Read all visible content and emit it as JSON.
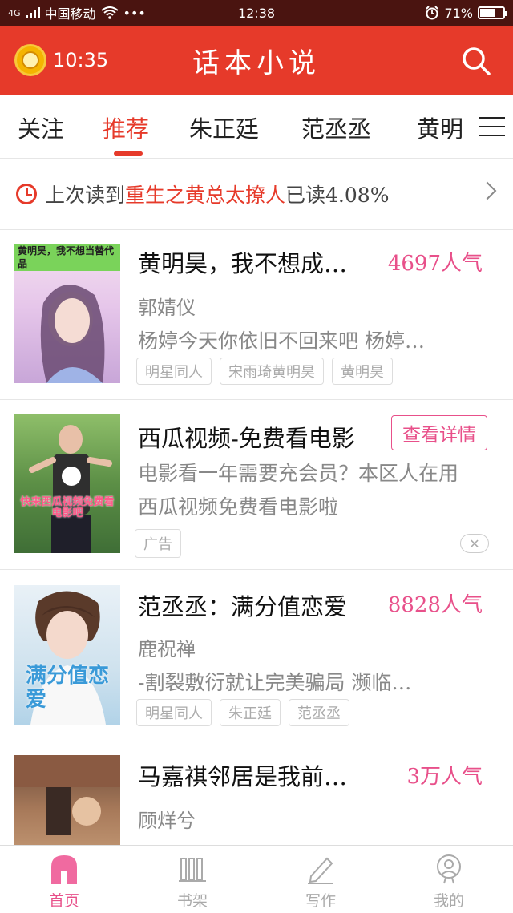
{
  "status_bar": {
    "network": "4G",
    "carrier": "中国移动",
    "dots": "•••",
    "time": "12:38",
    "battery": "71%",
    "battery_level": 0.71
  },
  "app_bar": {
    "timer": "10:35",
    "title": "话本小说",
    "search_icon": "search-icon"
  },
  "tabs": [
    {
      "label": "关注",
      "active": false
    },
    {
      "label": "推荐",
      "active": true
    },
    {
      "label": "朱正廷",
      "active": false
    },
    {
      "label": "范丞丞",
      "active": false
    },
    {
      "label": "黄明",
      "active": false
    }
  ],
  "last_read": {
    "prefix": "上次读到",
    "book": "重生之黄总太撩人",
    "progress": "已读4.08%"
  },
  "books": [
    {
      "title": "黄明昊，我不想成…",
      "popularity": "4697人气",
      "author": "郭婧仪",
      "desc": "杨婷今天你依旧不回来吧 杨婷…",
      "tags": [
        "明星同人",
        "宋雨琦黄明昊",
        "黄明昊"
      ],
      "cover_caption": "黄明昊，我不想当替代品"
    },
    {
      "title": "范丞丞：满分值恋爱",
      "popularity": "8828人气",
      "author": "鹿祝禅",
      "desc": "-割裂敷衍就让完美骗局 濒临…",
      "tags": [
        "明星同人",
        "朱正廷",
        "范丞丞"
      ],
      "cover_caption": "满分值恋爱"
    },
    {
      "title": "马嘉祺邻居是我前…",
      "popularity": "3万人气",
      "author": "顾烊兮"
    }
  ],
  "ad": {
    "title": "西瓜视频-免费看电影",
    "button": "查看详情",
    "desc_line1": "电影看一年需要充会员？本区人在用",
    "desc_line2": "西瓜视频免费看电影啦",
    "tag": "广告",
    "cover_caption": "快来西瓜视频免费看电影吧",
    "close": "✕"
  },
  "bottom_nav": [
    {
      "label": "首页",
      "icon": "home-icon",
      "active": true
    },
    {
      "label": "书架",
      "icon": "bookshelf-icon",
      "active": false
    },
    {
      "label": "写作",
      "icon": "pen-icon",
      "active": false
    },
    {
      "label": "我的",
      "icon": "profile-icon",
      "active": false
    }
  ],
  "colors": {
    "app_red": "#e63a2a",
    "pink": "#e8508a",
    "status_bar": "#4a1410"
  }
}
